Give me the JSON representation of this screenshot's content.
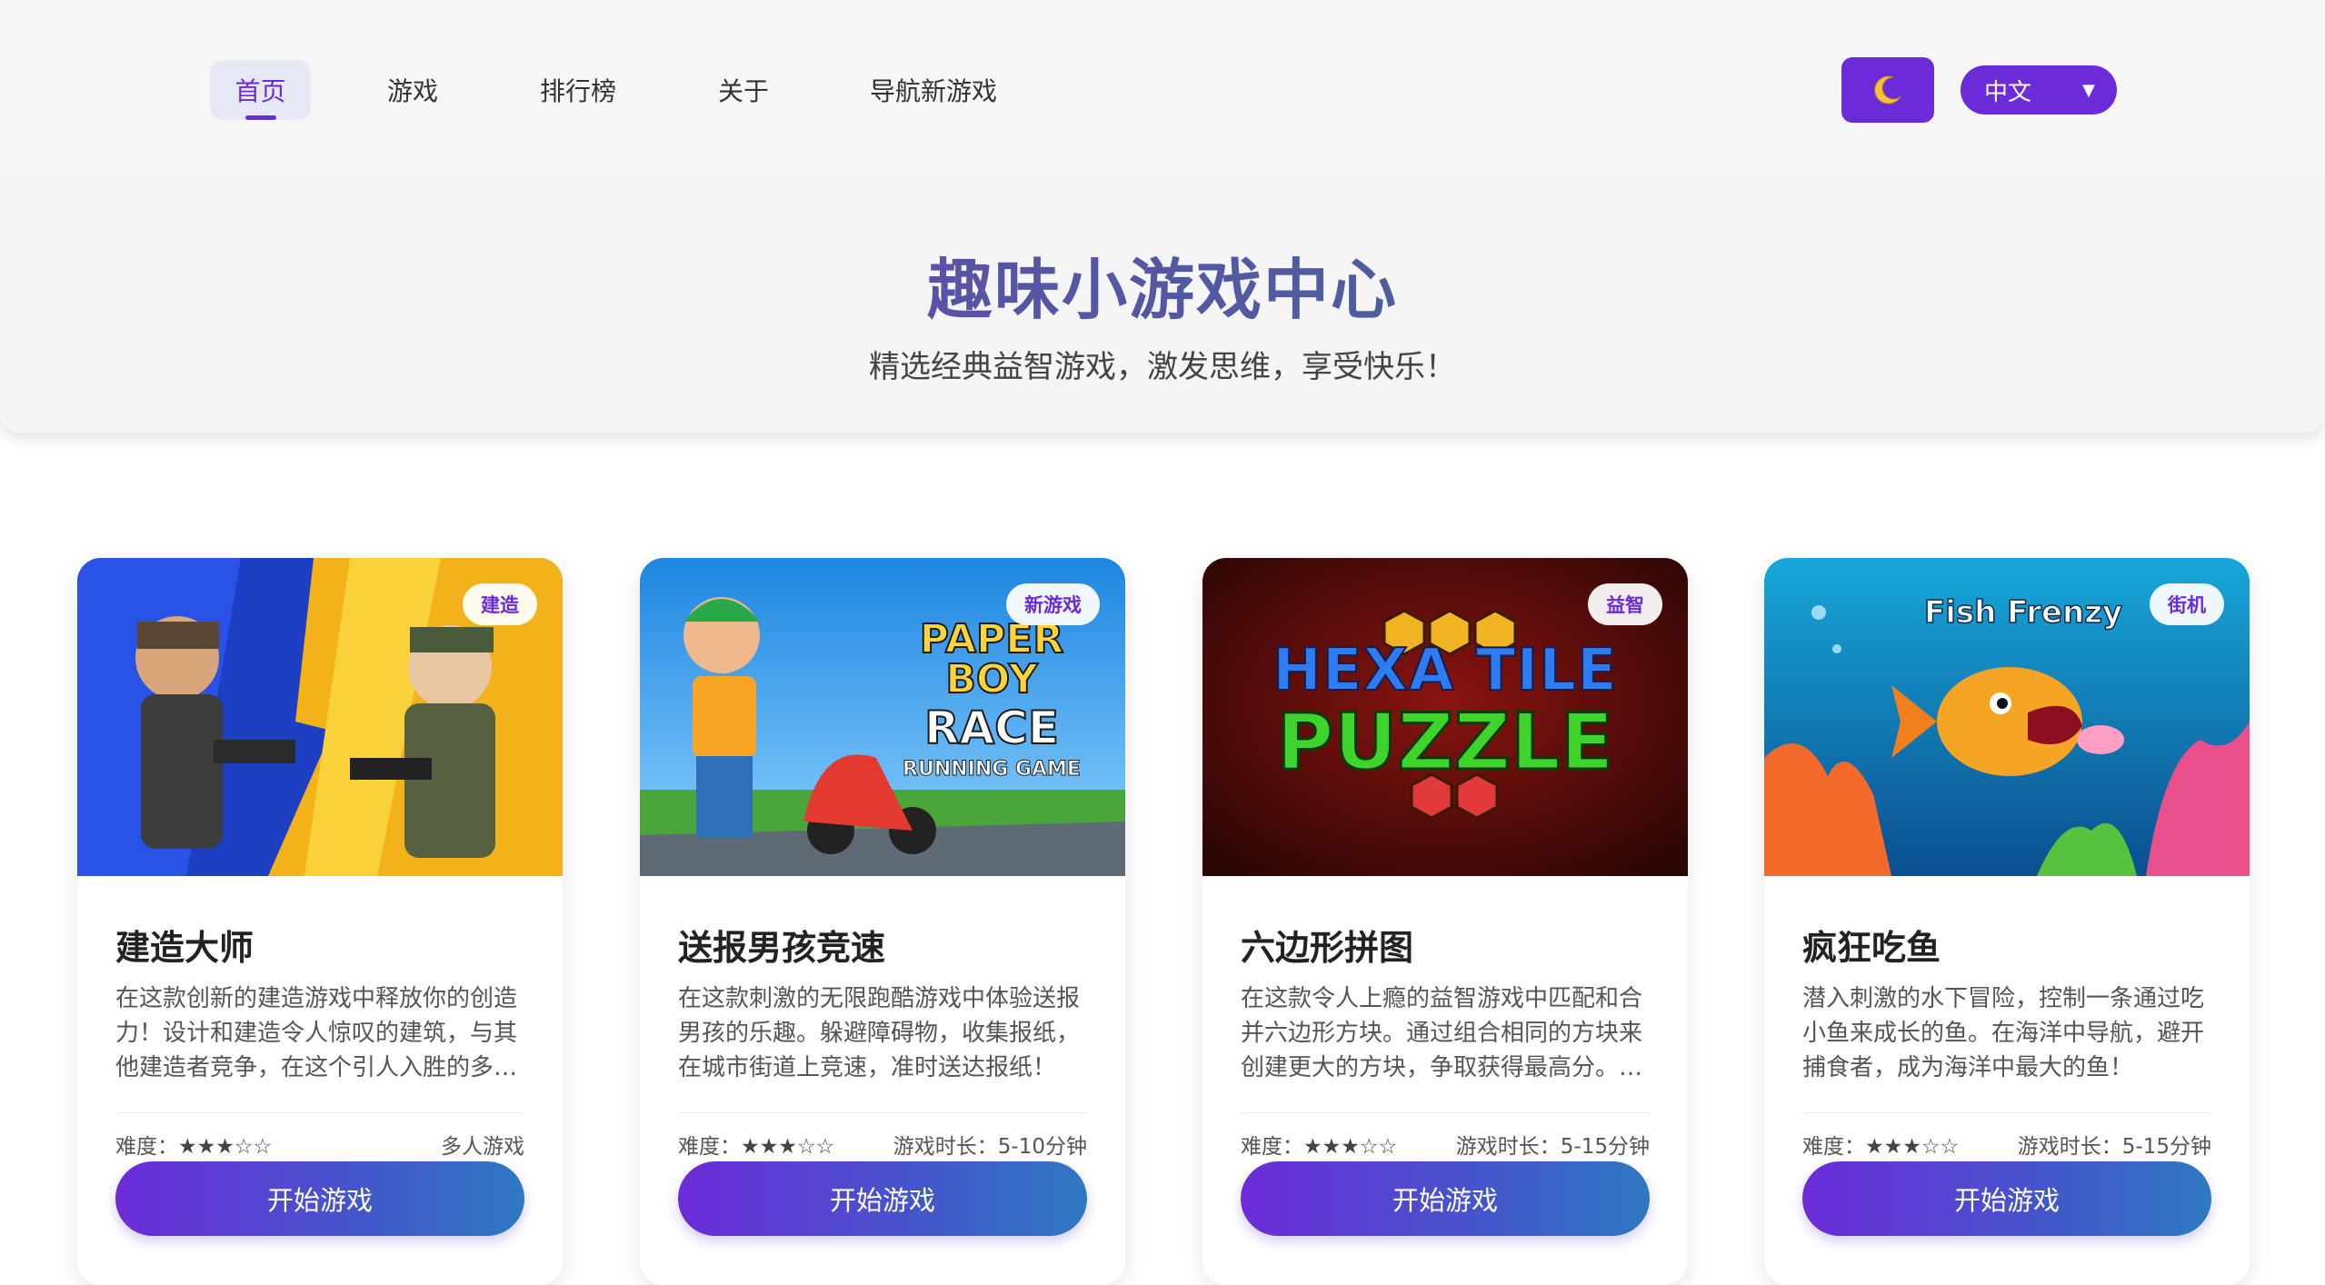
{
  "nav": {
    "items": [
      {
        "label": "首页",
        "active": true
      },
      {
        "label": "游戏"
      },
      {
        "label": "排行榜"
      },
      {
        "label": "关于"
      },
      {
        "label": "导航新游戏"
      }
    ],
    "theme_icon": "moon-icon",
    "language": "中文"
  },
  "hero": {
    "title": "趣味小游戏中心",
    "subtitle": "精选经典益智游戏，激发思维，享受快乐！"
  },
  "games": [
    {
      "tag": "建造",
      "image_text": "",
      "title": "建造大师",
      "description": "在这款创新的建造游戏中释放你的创造力！设计和建造令人惊叹的建筑，与其他建造者竞争，在这个引人入胜的多人...",
      "difficulty_label": "难度：",
      "stars": "★★★☆☆",
      "meta": "多人游戏",
      "button": "开始游戏"
    },
    {
      "tag": "新游戏",
      "image_text": {
        "line1": "PAPER BOY",
        "line2": "RACE",
        "line3": "RUNNING GAME"
      },
      "title": "送报男孩竞速",
      "description": "在这款刺激的无限跑酷游戏中体验送报男孩的乐趣。躲避障碍物，收集报纸，在城市街道上竞速，准时送达报纸！",
      "difficulty_label": "难度：",
      "stars": "★★★☆☆",
      "meta": "游戏时长：5-10分钟",
      "button": "开始游戏"
    },
    {
      "tag": "益智",
      "image_text": {
        "line1": "HEXA TILE",
        "line2": "PUZZLE"
      },
      "title": "六边形拼图",
      "description": "在这款令人上瘾的益智游戏中匹配和合并六边形方块。通过组合相同的方块来创建更大的方块，争取获得最高分。非...",
      "difficulty_label": "难度：",
      "stars": "★★★☆☆",
      "meta": "游戏时长：5-15分钟",
      "button": "开始游戏"
    },
    {
      "tag": "街机",
      "image_text": {
        "line1": "Fish Frenzy"
      },
      "title": "疯狂吃鱼",
      "description": "潜入刺激的水下冒险，控制一条通过吃小鱼来成长的鱼。在海洋中导航，避开捕食者，成为海洋中最大的鱼！",
      "difficulty_label": "难度：",
      "stars": "★★★☆☆",
      "meta": "游戏时长：5-15分钟",
      "button": "开始游戏"
    }
  ],
  "colors": {
    "accent": "#6c2bd9",
    "button_gradient_end": "#2f79c2"
  }
}
